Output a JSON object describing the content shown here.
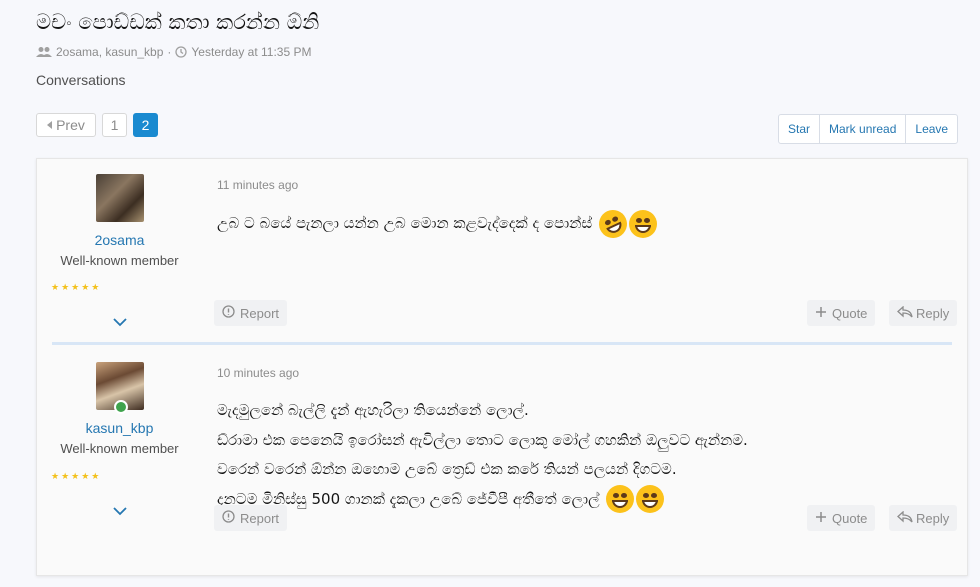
{
  "thread": {
    "title": "මචං පොඩ්ඩක් කතා කරන්න ඕනි",
    "participants": "2osama, kasun_kbp",
    "separator": "·",
    "time": "Yesterday at 11:35 PM",
    "breadcrumb": "Conversations"
  },
  "pagination": {
    "prev_label": "Prev",
    "pages": [
      "1",
      "2"
    ],
    "current": "2"
  },
  "actions": {
    "star": "Star",
    "mark_unread": "Mark unread",
    "leave": "Leave"
  },
  "messages": [
    {
      "username": "2osama",
      "role": "Well-known member",
      "stars": "★★★★★",
      "time": "11 minutes ago",
      "lines": [
        "උබ ට බයේ පැනලා යන්න උබ මොන කළවැද්දෙක් ද පොන්ස්"
      ],
      "report_label": "Report",
      "quote_label": "Quote",
      "reply_label": "Reply"
    },
    {
      "username": "kasun_kbp",
      "role": "Well-known member",
      "stars": "★★★★★",
      "time": "10 minutes ago",
      "lines": [
        "මැදමුලනේ බැල්ලි දැන් ඇහැරිලා තියෙන්නේ ලොල්.",
        "ඩ්රාමා එක පෙනෙයි ඉරෝසන් ඇවිල්ලා තොට ලොකු මෝල් ගහකින් ඔලුවට ඇන්නම.",
        "වරෙන් වරෙන් ඕන්න ඔහොම උබේ ත්‍රෙඩ් එක කරේ තියන් පලයන් දිගටම.",
        "දැනටම මිනිස්සු 500 ගානක් දැකලා උබේ ජේවීපී අතීතේ ලොල්"
      ],
      "report_label": "Report",
      "quote_label": "Quote",
      "reply_label": "Reply"
    }
  ],
  "colors": {
    "link": "#2577b1",
    "accent": "#1a8ad0",
    "stars": "#f3c11c",
    "online": "#3fa34d"
  }
}
